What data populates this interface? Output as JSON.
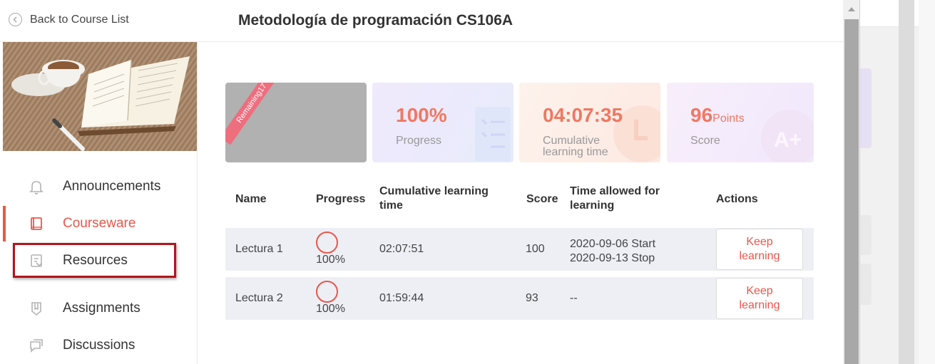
{
  "header": {
    "back_label": "Back to Course List",
    "title": "Metodología de programación CS106A"
  },
  "sidebar": {
    "items": [
      {
        "label": "Announcements",
        "icon": "bell-icon"
      },
      {
        "label": "Courseware",
        "icon": "book-icon",
        "active": true
      },
      {
        "label": "Resources",
        "icon": "resources-icon",
        "highlighted": true
      },
      {
        "label": "Assignments",
        "icon": "assignment-icon"
      },
      {
        "label": "Discussions",
        "icon": "discussion-icon"
      }
    ]
  },
  "stats": {
    "ribbon": "Remaining17",
    "progress_value": "100%",
    "progress_label": "Progress",
    "time_value": "04:07:35",
    "time_label_1": "Cumulative",
    "time_label_2": "learning time",
    "score_value": "96",
    "score_unit": "Points",
    "score_label": "Score"
  },
  "table": {
    "headers": {
      "name": "Name",
      "progress": "Progress",
      "time_1": "Cumulative learning",
      "time_2": "time",
      "score": "Score",
      "allowed_1": "Time allowed for",
      "allowed_2": "learning",
      "actions": "Actions"
    },
    "rows": [
      {
        "name": "Lectura 1",
        "progress": "100%",
        "time": "02:07:51",
        "score": "100",
        "allowed_1": "2020-09-06 Start",
        "allowed_2": "2020-09-13 Stop",
        "action_1": "Keep",
        "action_2": "learning"
      },
      {
        "name": "Lectura 2",
        "progress": "100%",
        "time": "01:59:44",
        "score": "93",
        "allowed_1": "--",
        "allowed_2": "",
        "action_1": "Keep",
        "action_2": "learning"
      }
    ]
  },
  "colors": {
    "accent": "#e8574a",
    "highlight_box": "#b3151b"
  }
}
